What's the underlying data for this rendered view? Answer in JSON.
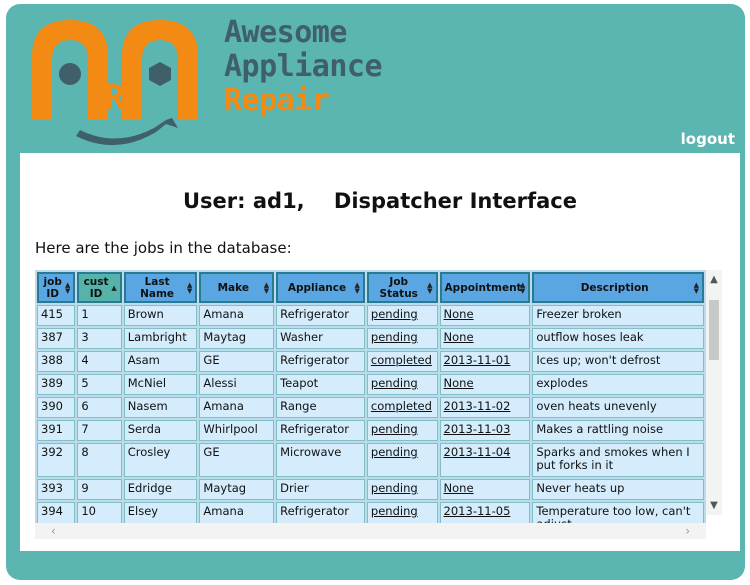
{
  "logo": {
    "line1": "Awesome",
    "line2": "Appliance",
    "line3": "Repair",
    "initials": "R"
  },
  "header": {
    "logout_label": "logout"
  },
  "main": {
    "title": "User: ad1,    Dispatcher Interface",
    "intro": "Here are the jobs in the database:"
  },
  "table": {
    "columns": [
      "job ID",
      "cust ID",
      "Last Name",
      "Make",
      "Appliance",
      "Job Status",
      "Appointment",
      "Description"
    ],
    "sorted_column": "cust ID",
    "rows": [
      [
        "415",
        "1",
        "Brown",
        "Amana",
        "Refrigerator",
        "pending",
        "None",
        "Freezer broken"
      ],
      [
        "387",
        "3",
        "Lambright",
        "Maytag",
        "Washer",
        "pending",
        "None",
        "outflow hoses leak"
      ],
      [
        "388",
        "4",
        "Asam",
        "GE",
        "Refrigerator",
        "completed",
        "2013-11-01",
        "Ices up; won't defrost"
      ],
      [
        "389",
        "5",
        "McNiel",
        "Alessi",
        "Teapot",
        "pending",
        "None",
        "explodes"
      ],
      [
        "390",
        "6",
        "Nasem",
        "Amana",
        "Range",
        "completed",
        "2013-11-02",
        "oven heats unevenly"
      ],
      [
        "391",
        "7",
        "Serda",
        "Whirlpool",
        "Refrigerator",
        "pending",
        "2013-11-03",
        "Makes a rattling noise"
      ],
      [
        "392",
        "8",
        "Crosley",
        "GE",
        "Microwave",
        "pending",
        "2013-11-04",
        "Sparks and smokes when I put forks in it"
      ],
      [
        "393",
        "9",
        "Edridge",
        "Maytag",
        "Drier",
        "pending",
        "None",
        "Never heats up"
      ],
      [
        "394",
        "10",
        "Elsey",
        "Amana",
        "Refrigerator",
        "pending",
        "2013-11-05",
        "Temperature too low, can't adjust."
      ]
    ]
  },
  "colors": {
    "frame": "#5bb5b0",
    "header_cell": "#5aa6e2",
    "sorted_header_cell": "#56b3a9",
    "row_cell": "#d4ecfb",
    "logo_orange": "#f28a14",
    "logo_gray": "#3f5f6a"
  }
}
